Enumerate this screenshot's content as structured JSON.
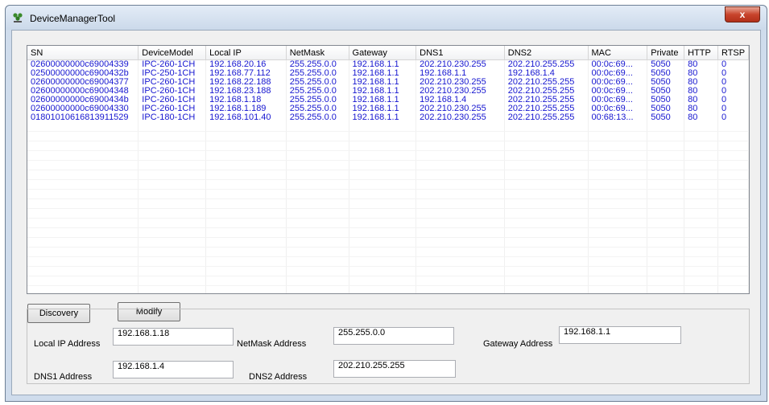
{
  "window": {
    "title": "DeviceManagerTool",
    "close_label": "x"
  },
  "table": {
    "columns": [
      "SN",
      "DeviceModel",
      "Local IP",
      "NetMask",
      "Gateway",
      "DNS1",
      "DNS2",
      "MAC",
      "Private",
      "HTTP",
      "RTSP"
    ],
    "rows": [
      [
        "02600000000c69004339",
        "IPC-260-1CH",
        "192.168.20.16",
        "255.255.0.0",
        "192.168.1.1",
        "202.210.230.255",
        "202.210.255.255",
        "00:0c:69...",
        "5050",
        "80",
        "0"
      ],
      [
        "02500000000c6900432b",
        "IPC-250-1CH",
        "192.168.77.112",
        "255.255.0.0",
        "192.168.1.1",
        "192.168.1.1",
        "192.168.1.4",
        "00:0c:69...",
        "5050",
        "80",
        "0"
      ],
      [
        "02600000000c69004377",
        "IPC-260-1CH",
        "192.168.22.188",
        "255.255.0.0",
        "192.168.1.1",
        "202.210.230.255",
        "202.210.255.255",
        "00:0c:69...",
        "5050",
        "80",
        "0"
      ],
      [
        "02600000000c69004348",
        "IPC-260-1CH",
        "192.168.23.188",
        "255.255.0.0",
        "192.168.1.1",
        "202.210.230.255",
        "202.210.255.255",
        "00:0c:69...",
        "5050",
        "80",
        "0"
      ],
      [
        "02600000000c6900434b",
        "IPC-260-1CH",
        "192.168.1.18",
        "255.255.0.0",
        "192.168.1.1",
        "192.168.1.4",
        "202.210.255.255",
        "00:0c:69...",
        "5050",
        "80",
        "0"
      ],
      [
        "02600000000c69004330",
        "IPC-260-1CH",
        "192.168.1.189",
        "255.255.0.0",
        "192.168.1.1",
        "202.210.230.255",
        "202.210.255.255",
        "00:0c:69...",
        "5050",
        "80",
        "0"
      ],
      [
        "01801010616813911529",
        "IPC-180-1CH",
        "192.168.101.40",
        "255.255.0.0",
        "192.168.1.1",
        "202.210.230.255",
        "202.210.255.255",
        "00:68:13...",
        "5050",
        "80",
        "0"
      ]
    ]
  },
  "buttons": {
    "discovery": "Discovery",
    "modify": "Modify"
  },
  "form": {
    "local_ip_label": "Local IP Address",
    "local_ip_value": "192.168.1.18",
    "netmask_label": "NetMask Address",
    "netmask_value": "255.255.0.0",
    "gateway_label": "Gateway Address",
    "gateway_value": "192.168.1.1",
    "dns1_label": "DNS1 Address",
    "dns1_value": "192.168.1.4",
    "dns2_label": "DNS2 Address",
    "dns2_value": "202.210.255.255"
  },
  "colors": {
    "row_text": "#1616d0",
    "client_bg": "#f0f0f0",
    "frame": "#cfdcec"
  },
  "icons": {
    "app": "device-manager-icon",
    "close": "close-icon"
  }
}
